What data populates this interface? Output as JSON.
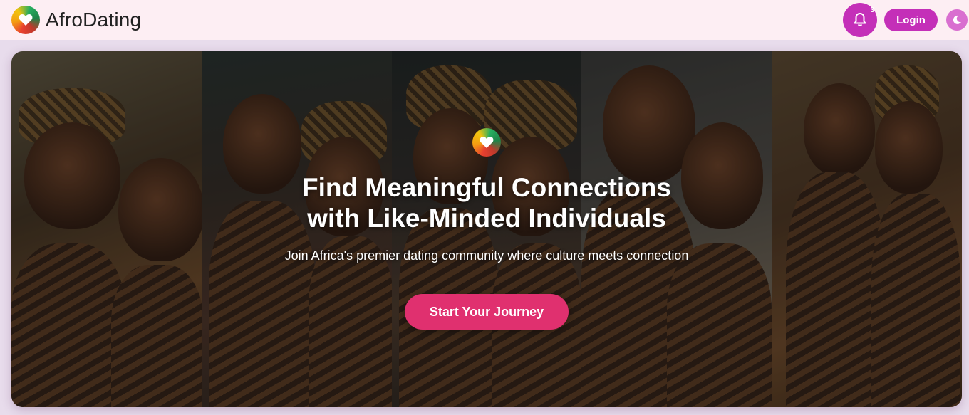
{
  "brand": {
    "name": "AfroDating",
    "logo_icon": "heart-icon"
  },
  "header": {
    "notifications": {
      "icon": "bell-icon",
      "count": "3"
    },
    "login_label": "Login",
    "theme_toggle_icon": "moon-icon"
  },
  "hero": {
    "icon": "heart-icon",
    "title_line1": "Find Meaningful Connections",
    "title_line2": "with Like-Minded Individuals",
    "subtitle": "Join Africa's premier dating community where culture meets connection",
    "cta_label": "Start Your Journey",
    "panels": [
      "couple-photo-1",
      "couple-photo-2",
      "couple-photo-3",
      "couple-photo-4",
      "couple-photo-5"
    ]
  },
  "colors": {
    "accent": "#c42fb8",
    "cta": "#e0306f",
    "header_bg": "#fdeef3",
    "page_bg": "#e8dcec"
  }
}
